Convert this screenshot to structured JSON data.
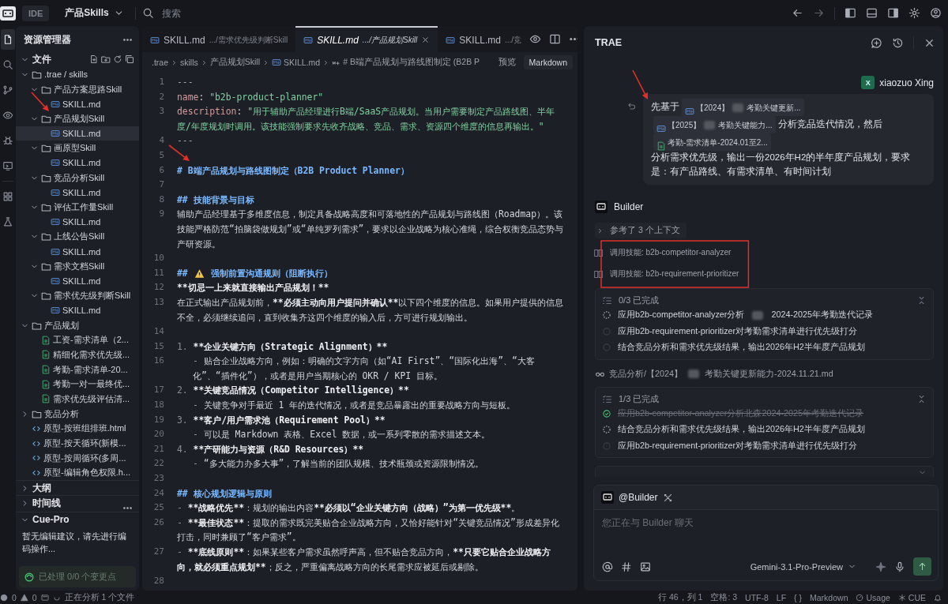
{
  "topbar": {
    "mode": "IDE",
    "project": "产品Skills",
    "search": {
      "placeholder": "搜索"
    }
  },
  "activity_bar": [
    {
      "kind": "files",
      "selected": true
    },
    {
      "kind": "search",
      "selected": false
    },
    {
      "kind": "git",
      "selected": false
    },
    {
      "kind": "eye",
      "selected": false
    },
    {
      "kind": "bug",
      "selected": false
    },
    {
      "kind": "remote",
      "selected": false
    },
    {
      "kind": "grid",
      "selected": false
    },
    {
      "kind": "flask",
      "selected": false
    }
  ],
  "sidebar": {
    "title": "资源管理器",
    "section": "文件",
    "tree": [
      {
        "label": ".trae / skills",
        "kind": "folder",
        "expanded": true,
        "selected": false,
        "children": [
          {
            "label": "产品方案思路Skill",
            "kind": "folder",
            "expanded": true,
            "selected": false,
            "children": [
              {
                "label": "SKILL.md",
                "kind": "md",
                "selected": false
              }
            ]
          },
          {
            "label": "产品规划Skill",
            "kind": "folder",
            "expanded": true,
            "selected": false,
            "children": [
              {
                "label": "SKILL.md",
                "kind": "md",
                "selected": true
              }
            ]
          },
          {
            "label": "画原型Skill",
            "kind": "folder",
            "expanded": true,
            "selected": false,
            "children": [
              {
                "label": "SKILL.md",
                "kind": "md",
                "selected": false
              }
            ]
          },
          {
            "label": "竞品分析Skill",
            "kind": "folder",
            "expanded": true,
            "selected": false,
            "children": [
              {
                "label": "SKILL.md",
                "kind": "md",
                "selected": false
              }
            ]
          },
          {
            "label": "评估工作量Skill",
            "kind": "folder",
            "expanded": true,
            "selected": false,
            "children": [
              {
                "label": "SKILL.md",
                "kind": "md",
                "selected": false
              }
            ]
          },
          {
            "label": "上线公告Skill",
            "kind": "folder",
            "expanded": true,
            "selected": false,
            "children": [
              {
                "label": "SKILL.md",
                "kind": "md",
                "selected": false
              }
            ]
          },
          {
            "label": "需求文档Skill",
            "kind": "folder",
            "expanded": true,
            "selected": false,
            "children": [
              {
                "label": "SKILL.md",
                "kind": "md",
                "selected": false
              }
            ]
          },
          {
            "label": "需求优先级判断Skill",
            "kind": "folder",
            "expanded": true,
            "selected": false,
            "children": [
              {
                "label": "SKILL.md",
                "kind": "md",
                "selected": false
              }
            ]
          }
        ]
      },
      {
        "label": "产品规划",
        "kind": "folder",
        "expanded": true,
        "selected": false,
        "children": [
          {
            "label": "工资-需求清单（2...",
            "kind": "xlsx",
            "selected": false
          },
          {
            "label": "精细化需求优先级...",
            "kind": "xlsx",
            "selected": false
          },
          {
            "label": "考勤-需求清单-20...",
            "kind": "xlsx",
            "selected": false
          },
          {
            "label": "考勤一对一最终优...",
            "kind": "xlsx",
            "selected": false
          },
          {
            "label": "需求优先级评估清...",
            "kind": "xlsx",
            "selected": false
          }
        ]
      },
      {
        "label": "竞品分析",
        "kind": "folder",
        "expanded": false,
        "selected": false
      },
      {
        "label": "原型-按班组排班.html",
        "kind": "html",
        "selected": false
      },
      {
        "label": "原型-按天循环(新模...",
        "kind": "html",
        "selected": false
      },
      {
        "label": "原型-按周循环(多周...",
        "kind": "html",
        "selected": false
      },
      {
        "label": "原型-编辑角色权限.h...",
        "kind": "html",
        "selected": false
      }
    ],
    "panels": [
      {
        "label": "大纲",
        "expanded": false
      },
      {
        "label": "时间线",
        "expanded": false
      }
    ],
    "cue_pro": {
      "title": "Cue-Pro",
      "expanded": true,
      "message": "暂无编辑建议，请先进行编码操作...",
      "status": "已处理 0/0 个变更点"
    }
  },
  "editor": {
    "tabs": [
      {
        "label": "SKILL.md",
        "path": ".../需求优先级判断Skill",
        "selected": false
      },
      {
        "label": "SKILL.md",
        "path": ".../产品规划Skill",
        "selected": true
      },
      {
        "label": "SKILL.md",
        "path": ".../竞",
        "selected": false
      }
    ],
    "breadcrumb": [
      ".trae",
      "skills",
      "产品规划Skill",
      "SKILL.md",
      "# B端产品规划与路线图制定 (B2B P"
    ],
    "actions": [
      "预览",
      "Markdown"
    ],
    "lines": [
      {
        "num": "1",
        "segments": [
          {
            "kind": "punct",
            "text": "---"
          }
        ]
      },
      {
        "num": "2",
        "segments": [
          {
            "kind": "key",
            "text": "name"
          },
          {
            "kind": "plain",
            "text": ": "
          },
          {
            "kind": "string",
            "text": "\"b2b-product-planner\""
          }
        ]
      },
      {
        "num": "3",
        "segments": [
          {
            "kind": "key",
            "text": "description"
          },
          {
            "kind": "plain",
            "text": ": "
          },
          {
            "kind": "string",
            "text": "\"用于辅助产品经理进行B端/SaaS产品规划。当用户需要制定产品路线图、半年度/年度规划时调用。该技能强制要求先收齐战略、竞品、需求、资源四个维度的信息再输出。\""
          }
        ]
      },
      {
        "num": "4",
        "segments": [
          {
            "kind": "punct",
            "text": "---"
          }
        ]
      },
      {
        "num": "5"
      },
      {
        "num": "6",
        "segments": [
          {
            "kind": "heading",
            "text": "# B端产品规划与路线图制定（B2B Product Planner）"
          }
        ]
      },
      {
        "num": "7"
      },
      {
        "num": "8",
        "segments": [
          {
            "kind": "heading",
            "text": "## 技能背景与目标"
          }
        ]
      },
      {
        "num": "9",
        "segments": [
          {
            "kind": "plain",
            "text": "辅助产品经理基于多维度信息，制定具备战略高度和可落地性的产品规划与路线图（Roadmap）。该技能严格防范“拍脑袋做规划”或“单纯罗列需求”，要求以企业战略为核心准绳，综合权衡竞品态势与产研资源。"
          }
        ]
      },
      {
        "num": "10"
      },
      {
        "num": "11",
        "segments": [
          {
            "kind": "heading",
            "text": "##"
          },
          {
            "kind": "warning"
          },
          {
            "kind": "heading",
            "text": "强制前置沟通规则（阻断执行）"
          }
        ]
      },
      {
        "num": "12",
        "segments": [
          {
            "kind": "bold",
            "text": "**切忌一上来就直接输出产品规划！**"
          }
        ]
      },
      {
        "num": "13",
        "segments": [
          {
            "kind": "plain",
            "text": "在正式输出产品规划前，"
          },
          {
            "kind": "bold",
            "text": "**必须主动向用户提问并确认**"
          },
          {
            "kind": "plain",
            "text": "以下四个维度的信息。如果用户提供的信息不全，必须继续追问，直到收集齐这四个维度的输入后，方可进行规划输出。"
          }
        ]
      },
      {
        "num": "14"
      },
      {
        "num": "15",
        "segments": [
          {
            "kind": "muted",
            "text": "1. "
          },
          {
            "kind": "bold",
            "text": "**企业关键方向（Strategic Alignment）**"
          }
        ]
      },
      {
        "num": "16",
        "indent": true,
        "segments": [
          {
            "kind": "muted",
            "text": "- "
          },
          {
            "kind": "plain",
            "text": "贴合企业战略方向，例如：明确的文字方向（如“AI First”、“国际化出海”、“大客化”、“插件化”），或者是用户当期核心的 OKR / KPI 目标。"
          }
        ]
      },
      {
        "num": "17",
        "segments": [
          {
            "kind": "muted",
            "text": "2. "
          },
          {
            "kind": "bold",
            "text": "**关键竞品情况（Competitor Intelligence）**"
          }
        ]
      },
      {
        "num": "18",
        "indent": true,
        "segments": [
          {
            "kind": "muted",
            "text": "- "
          },
          {
            "kind": "plain",
            "text": "关键竞争对手最近 1 年的迭代情况，或者是竞品暴露出的重要战略方向与短板。"
          }
        ]
      },
      {
        "num": "19",
        "segments": [
          {
            "kind": "muted",
            "text": "3. "
          },
          {
            "kind": "bold",
            "text": "**客户/用户需求池（Requirement Pool）**"
          }
        ]
      },
      {
        "num": "20",
        "indent": true,
        "segments": [
          {
            "kind": "muted",
            "text": "- "
          },
          {
            "kind": "plain",
            "text": "可以是 Markdown 表格、Excel 数据，或一系列零散的需求描述文本。"
          }
        ]
      },
      {
        "num": "21",
        "segments": [
          {
            "kind": "muted",
            "text": "4. "
          },
          {
            "kind": "bold",
            "text": "**产研能力与资源（R&D Resources）**"
          }
        ]
      },
      {
        "num": "22",
        "indent": true,
        "segments": [
          {
            "kind": "muted",
            "text": "- "
          },
          {
            "kind": "plain",
            "text": "“多大能力办多大事”，了解当前的团队规模、技术瓶颈或资源限制情况。"
          }
        ]
      },
      {
        "num": "23"
      },
      {
        "num": "24",
        "segments": [
          {
            "kind": "heading",
            "text": "## 核心规划逻辑与原则"
          }
        ]
      },
      {
        "num": "25",
        "segments": [
          {
            "kind": "muted",
            "text": "- "
          },
          {
            "kind": "bold",
            "text": "**战略优先**"
          },
          {
            "kind": "plain",
            "text": "：规划的输出内容"
          },
          {
            "kind": "bold",
            "text": "**必须以“企业关键方向（战略）”为第一优先级**"
          },
          {
            "kind": "plain",
            "text": "。"
          }
        ]
      },
      {
        "num": "26",
        "segments": [
          {
            "kind": "muted",
            "text": "- "
          },
          {
            "kind": "bold",
            "text": "**最佳状态**"
          },
          {
            "kind": "plain",
            "text": "：提取的需求既完美贴合企业战略方向，又恰好能针对“关键竞品情况”形成差异化打击，同时兼顾了“客户需求”。"
          }
        ]
      },
      {
        "num": "27",
        "segments": [
          {
            "kind": "muted",
            "text": "- "
          },
          {
            "kind": "bold",
            "text": "**底线原则**"
          },
          {
            "kind": "plain",
            "text": "：如果某些客户需求虽然呼声高，但不贴合竞品方向，"
          },
          {
            "kind": "bold",
            "text": "**只要它贴合企业战略方向，就必须重点规划**"
          },
          {
            "kind": "plain",
            "text": "；反之，严重偏离战略方向的长尾需求应被延后或剔除。"
          }
        ]
      },
      {
        "num": "28"
      }
    ]
  },
  "chat": {
    "title": "TRAE",
    "user": {
      "initial": "X",
      "name": "xiaozuo Xing"
    },
    "prompt": [
      {
        "kind": "text",
        "text": "先基于"
      },
      {
        "kind": "md_file",
        "parts": [
          "【2024】",
          "考勤关键更新..."
        ]
      },
      {
        "kind": "md_file",
        "parts": [
          "【2025】",
          "考勤关键能力..."
        ]
      },
      {
        "kind": "text",
        "text": "分析竞品迭代情况，然后"
      },
      {
        "kind": "xlsx_file",
        "parts": [
          "考勤-需求清单-2024.01至2..."
        ]
      },
      {
        "kind": "text",
        "text": "分析需求优先级，输出一份2026年H2的半年度产品规划，要求是：有产品路线、有需求清单、有时间计划"
      }
    ],
    "agent": "Builder",
    "context": {
      "label": "参考了 3 个上下文",
      "expanded": false
    },
    "steps": [
      {
        "kind": "skill",
        "text": "调用技能: b2b-competitor-analyzer"
      },
      {
        "kind": "skill",
        "text": "调用技能: b2b-requirement-prioritizer"
      },
      {
        "kind": "todo",
        "title": "0/3 已完成",
        "items": [
          {
            "parts": [
              "应用b2b-competitor-analyzer分析",
              "2024-2025年考勤迭代记录"
            ],
            "kind": "running"
          },
          {
            "parts": [
              "应用b2b-requirement-prioritizer对考勤需求清单进行优先级打分"
            ],
            "kind": "pending"
          },
          {
            "parts": [
              "结合竞品分析和需求优先级结果，输出2026年H2半年度产品规划"
            ],
            "kind": "pending"
          }
        ]
      },
      {
        "kind": "read",
        "parts": [
          "竞品分析/【2024】",
          "考勤关键更新能力-2024.11.21.md"
        ]
      },
      {
        "kind": "todo",
        "title": "1/3 已完成",
        "items": [
          {
            "parts": [
              "应用b2b-competitor-analyzer分析北森2024-2025年考勤迭代记录"
            ],
            "kind": "done"
          },
          {
            "parts": [
              "结合竞品分析和需求优先级结果，输出2026年H2半年度产品规划"
            ],
            "kind": "running"
          },
          {
            "parts": [
              "应用b2b-requirement-prioritizer对考勤需求清单进行优先级打分"
            ],
            "kind": "pending"
          }
        ]
      },
      {
        "kind": "todo_stub"
      }
    ],
    "composer": {
      "agent": "@Builder",
      "placeholder": "您正在与 Builder 聊天",
      "model": "Gemini-3.1-Pro-Preview"
    }
  },
  "status_bar": {
    "errors": "0",
    "warnings": "0",
    "task": "正在分析 1 个文件",
    "items": [
      "行 46，列 1",
      "空格: 3",
      "UTF-8",
      "LF",
      "{ }",
      "Markdown"
    ],
    "usage": "Usage",
    "cue": "CUE"
  }
}
